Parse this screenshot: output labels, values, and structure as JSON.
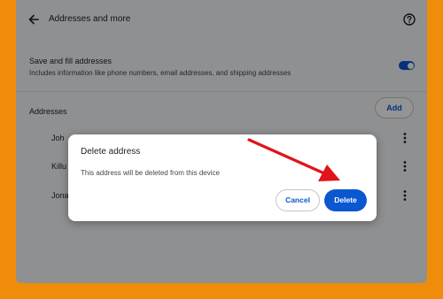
{
  "page": {
    "title": "Addresses and more",
    "back_icon": "arrow-left-icon",
    "help_icon": "help-circle-icon"
  },
  "setting": {
    "title": "Save and fill addresses",
    "description": "Includes information like phone numbers, email addresses, and shipping addresses",
    "toggle_on": true
  },
  "addresses": {
    "label": "Addresses",
    "add_label": "Add",
    "items": [
      {
        "name": "Joh",
        "menu_icon": "more-vert-icon"
      },
      {
        "name": "Killu",
        "menu_icon": "more-vert-icon"
      },
      {
        "name": "Jona",
        "menu_icon": "more-vert-icon"
      }
    ]
  },
  "dialog": {
    "title": "Delete address",
    "body": "This address will be deleted from this device",
    "cancel_label": "Cancel",
    "delete_label": "Delete"
  },
  "annotation": {
    "type": "arrow",
    "color": "#e0141a",
    "points_to": "delete-button"
  },
  "colors": {
    "frame": "#f08c0c",
    "accent": "#0b57d0",
    "panel": "#f6f8fc"
  }
}
